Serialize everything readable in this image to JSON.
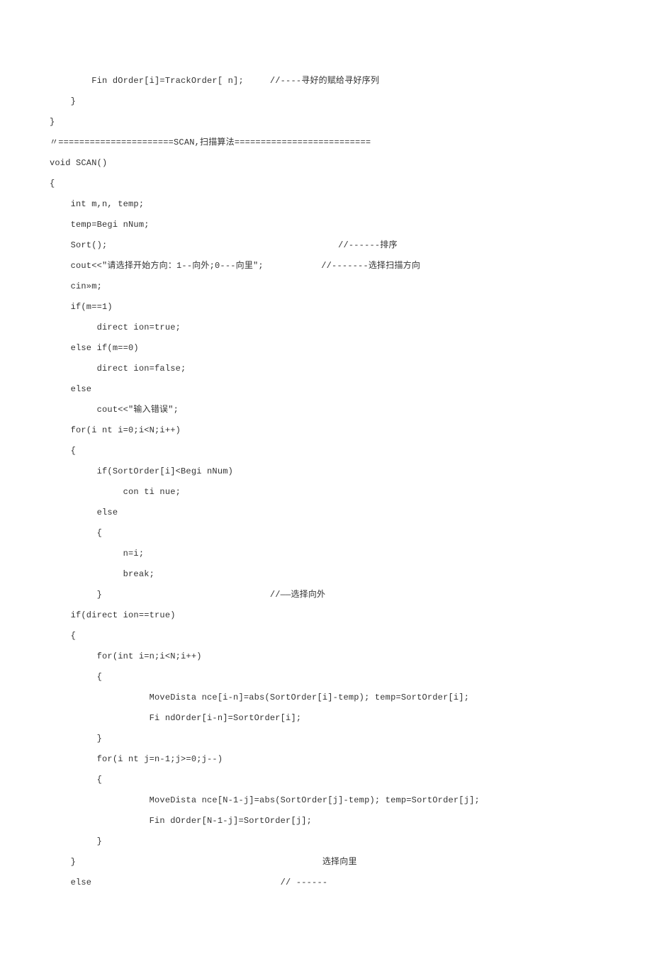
{
  "lines": [
    "        Fin dOrder[i]=TrackOrder[ n];     //----寻好的赋给寻好序列",
    "    }",
    "}",
    "",
    "〃======================SCAN,扫描算法==========================",
    "void SCAN()",
    "{",
    "    int m,n, temp;",
    "    temp=Begi nNum;",
    "    Sort();                                            //------排序",
    "    cout<<\"请选择开始方向：1--向外;0---向里\";           //-------选择扫描方向",
    "    cin»m;",
    "    if(m==1)",
    "         direct ion=true;",
    "    else if(m==0)",
    "         direct ion=false;",
    "    else",
    "         cout<<\"输入错误\";",
    "    for(i nt i=0;i<N;i++)",
    "    {",
    "         if(SortOrder[i]<Begi nNum)",
    "              con ti nue;",
    "         else",
    "         {",
    "              n=i;",
    "              break;",
    "         }                                //——选择向外",
    "",
    "",
    "    if(direct ion==true)",
    "    {",
    "         for(int i=n;i<N;i++)",
    "         {",
    "                   MoveDista nce[i-n]=abs(SortOrder[i]-temp); temp=SortOrder[i];",
    "                   Fi ndOrder[i-n]=SortOrder[i];",
    "         }",
    "         for(i nt j=n-1;j>=0;j--)",
    "         {",
    "                   MoveDista nce[N-1-j]=abs(SortOrder[j]-temp); temp=SortOrder[j];",
    "                   Fin dOrder[N-1-j]=SortOrder[j];",
    "         }",
    "    }                                               选择向里",
    "    else                                    // ------"
  ]
}
